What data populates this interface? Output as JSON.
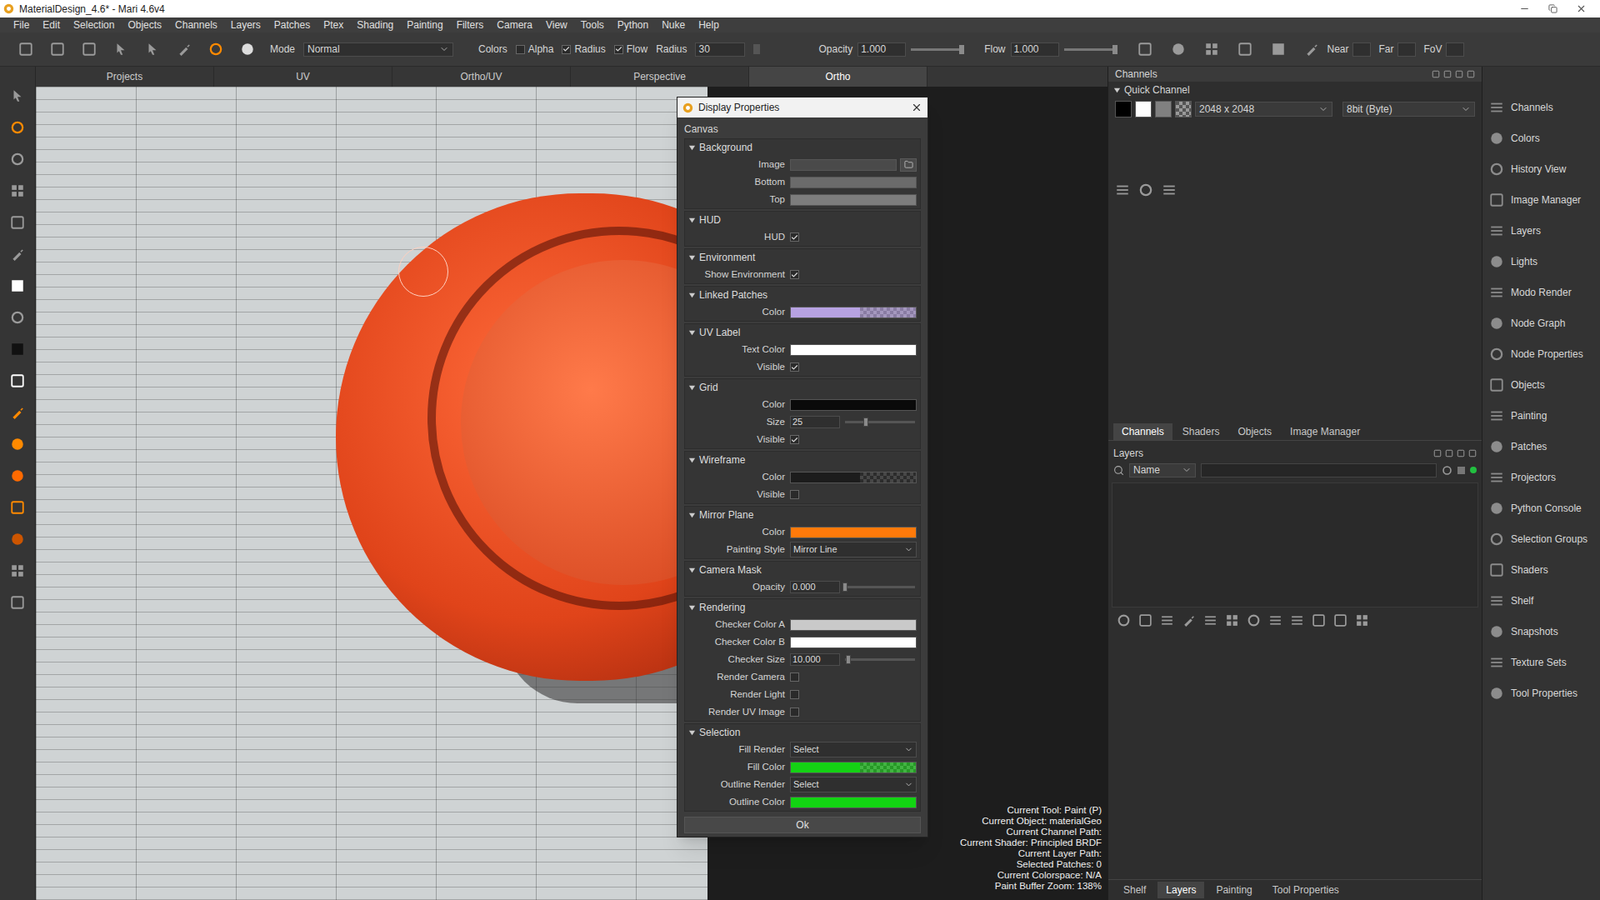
{
  "window": {
    "title": "MaterialDesign_4.6* - Mari 4.6v4"
  },
  "menu": [
    "File",
    "Edit",
    "Selection",
    "Objects",
    "Channels",
    "Layers",
    "Patches",
    "Ptex",
    "Shading",
    "Painting",
    "Filters",
    "Camera",
    "View",
    "Tools",
    "Python",
    "Nuke",
    "Help"
  ],
  "toolbar": {
    "mode_label": "Mode",
    "mode_value": "Normal",
    "colors_label": "Colors",
    "toggles": [
      {
        "label": "Alpha",
        "checked": false
      },
      {
        "label": "Radius",
        "checked": true
      },
      {
        "label": "Flow",
        "checked": true
      }
    ],
    "radius": {
      "label": "Radius",
      "value": "30"
    },
    "sliders": [
      {
        "label": "Opacity",
        "value": "1.000",
        "level": 1
      },
      {
        "label": "Flow",
        "value": "1.000",
        "level": 1
      }
    ],
    "camera": [
      "Near",
      "Far",
      "FoV"
    ]
  },
  "viewport_tabs": [
    {
      "label": "Projects",
      "selected": false
    },
    {
      "label": "UV",
      "selected": false
    },
    {
      "label": "Ortho/UV",
      "selected": false
    },
    {
      "label": "Perspective",
      "selected": false
    },
    {
      "label": "Ortho",
      "selected": true
    }
  ],
  "status": [
    "Current Tool: Paint (P)",
    "Current Object: materialGeo",
    "Current Channel Path:",
    "Current Shader: Principled BRDF",
    "Current Layer Path:",
    "Selected Patches: 0",
    "Current Colorspace: N/A",
    "Paint Buffer Zoom: 138%"
  ],
  "dialog": {
    "title": "Display Properties",
    "group": "Canvas",
    "ok": "Ok",
    "sections": [
      {
        "title": "Background",
        "expanded": true,
        "rows": [
          {
            "label": "Image",
            "kind": "image"
          },
          {
            "label": "Bottom",
            "kind": "color",
            "color": "#6b6b6b",
            "pattern": false
          },
          {
            "label": "Top",
            "kind": "color",
            "color": "#7d7d7d",
            "pattern": false
          }
        ]
      },
      {
        "title": "HUD",
        "expanded": true,
        "rows": [
          {
            "label": "HUD",
            "kind": "check",
            "checked": true
          }
        ]
      },
      {
        "title": "Environment",
        "expanded": true,
        "rows": [
          {
            "label": "Show Environment",
            "kind": "check",
            "checked": true
          }
        ]
      },
      {
        "title": "Linked Patches",
        "expanded": true,
        "rows": [
          {
            "label": "Color",
            "kind": "color",
            "color": "#b7a2e2",
            "pattern": true
          }
        ]
      },
      {
        "title": "UV Label",
        "expanded": true,
        "rows": [
          {
            "label": "Text Color",
            "kind": "color",
            "color": "#ffffff",
            "pattern": false
          },
          {
            "label": "Visible",
            "kind": "check",
            "checked": true
          }
        ]
      },
      {
        "title": "Grid",
        "expanded": true,
        "rows": [
          {
            "label": "Color",
            "kind": "color",
            "color": "#0a0a0a",
            "pattern": false
          },
          {
            "label": "Size",
            "kind": "number",
            "value": "25",
            "level": 0.3
          },
          {
            "label": "Visible",
            "kind": "check",
            "checked": true
          }
        ]
      },
      {
        "title": "Wireframe",
        "expanded": true,
        "rows": [
          {
            "label": "Color",
            "kind": "color",
            "color": "#1c1c1c",
            "pattern": true
          },
          {
            "label": "Visible",
            "kind": "check",
            "checked": false
          }
        ]
      },
      {
        "title": "Mirror Plane",
        "expanded": true,
        "rows": [
          {
            "label": "Color",
            "kind": "color",
            "color": "#ff7a0a",
            "pattern": false
          },
          {
            "label": "Painting Style",
            "kind": "select",
            "value": "Mirror Line"
          }
        ]
      },
      {
        "title": "Camera Mask",
        "expanded": true,
        "rows": [
          {
            "label": "Opacity",
            "kind": "number",
            "value": "0.000",
            "level": 0
          }
        ]
      },
      {
        "title": "Rendering",
        "expanded": true,
        "rows": [
          {
            "label": "Checker Color A",
            "kind": "color",
            "color": "#c9c9c9",
            "pattern": false
          },
          {
            "label": "Checker Color B",
            "kind": "color",
            "color": "#ffffff",
            "pattern": false
          },
          {
            "label": "Checker Size",
            "kind": "number",
            "value": "10.000",
            "level": 0.05
          },
          {
            "label": "Render Camera",
            "kind": "check",
            "checked": false
          },
          {
            "label": "Render Light",
            "kind": "check",
            "checked": false
          },
          {
            "label": "Render UV Image",
            "kind": "check",
            "checked": false
          }
        ]
      },
      {
        "title": "Selection",
        "expanded": true,
        "rows": [
          {
            "label": "Fill Render",
            "kind": "select",
            "value": "Select"
          },
          {
            "label": "Fill Color",
            "kind": "color",
            "color": "#14d214",
            "pattern": true
          },
          {
            "label": "Outline Render",
            "kind": "select",
            "value": "Select"
          },
          {
            "label": "Outline Color",
            "kind": "color",
            "color": "#12d412",
            "pattern": false
          }
        ]
      }
    ]
  },
  "channels_panel": {
    "title": "Channels",
    "quick": {
      "label": "Quick Channel",
      "expanded": true
    },
    "size": "2048 x 2048",
    "depth": "8bit (Byte)"
  },
  "panel_tabs": [
    {
      "label": "Channels",
      "selected": true
    },
    {
      "label": "Shaders",
      "selected": false
    },
    {
      "label": "Objects",
      "selected": false
    },
    {
      "label": "Image Manager",
      "selected": false
    }
  ],
  "layers_panel": {
    "title": "Layers",
    "filter": "Name"
  },
  "bottom_tabs": [
    {
      "label": "Shelf",
      "selected": false
    },
    {
      "label": "Layers",
      "selected": true
    },
    {
      "label": "Painting",
      "selected": false
    },
    {
      "label": "Tool Properties",
      "selected": false
    }
  ],
  "sidebar": [
    "Channels",
    "Colors",
    "History View",
    "Image Manager",
    "Layers",
    "Lights",
    "Modo Render",
    "Node Graph",
    "Node Properties",
    "Objects",
    "Painting",
    "Patches",
    "Projectors",
    "Python Console",
    "Selection Groups",
    "Shaders",
    "Shelf",
    "Snapshots",
    "Texture Sets",
    "Tool Properties"
  ]
}
